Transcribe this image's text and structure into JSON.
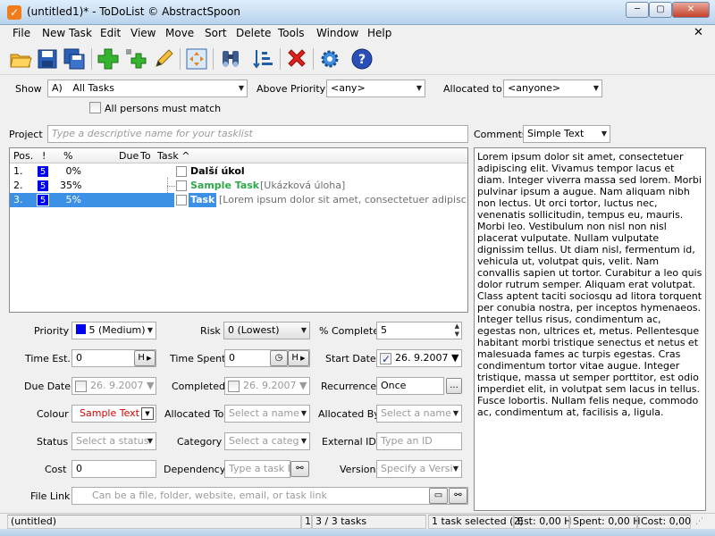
{
  "window": {
    "title": "(untitled1)* - ToDoList © AbstractSpoon",
    "minimize": "─",
    "maximize": "▢",
    "close": "✕"
  },
  "menu": [
    "File",
    "New Task",
    "Edit",
    "View",
    "Move",
    "Sort",
    "Delete",
    "Tools",
    "Window",
    "Help"
  ],
  "menu_close": "✕",
  "filter": {
    "show_label": "Show",
    "show_prefix": "A)",
    "show_value": "All Tasks",
    "above_priority_label": "Above Priority",
    "above_priority_value": "<any>",
    "allocated_to_label": "Allocated to",
    "allocated_to_value": "<anyone>",
    "all_persons_label": "All persons must match"
  },
  "project": {
    "label": "Project",
    "placeholder": "Type a descriptive name for your tasklist"
  },
  "comments_header": {
    "label": "Comments",
    "format": "Simple Text"
  },
  "tasklist": {
    "columns": {
      "pos": "Pos.",
      "flag": "!",
      "percent": "%",
      "due": "Due",
      "to": "To",
      "task": "Task ^"
    },
    "rows": [
      {
        "pos": "1.",
        "priority": "5",
        "percent": "0%",
        "title": "Další úkol",
        "comment": ""
      },
      {
        "pos": "2.",
        "priority": "5",
        "percent": "35%",
        "title": "Sample Task",
        "comment": "[Ukázková úloha]"
      },
      {
        "pos": "3.",
        "priority": "5",
        "percent": "5%",
        "title": "Task",
        "comment": "[Lorem ipsum dolor sit amet, consectetuer adipiscing elit. V"
      }
    ]
  },
  "comments_text": "Lorem ipsum dolor sit amet, consectetuer adipiscing elit. Vivamus tempor lacus et diam. Integer viverra massa sed lorem. Morbi pulvinar ipsum a augue. Nam aliquam nibh non lectus. Ut orci tortor, luctus nec, venenatis sollicitudin, tempus eu, mauris. Morbi leo. Vestibulum non nisl non nisl placerat vulputate. Nullam vulputate dignissim tellus. Ut diam nisl, fermentum id, vehicula ut, volutpat quis, velit. Nam convallis sapien ut tortor. Curabitur a leo quis dolor rutrum semper. Aliquam erat volutpat. Class aptent taciti sociosqu ad litora torquent per conubia nostra, per inceptos hymenaeos. Integer tellus risus, condimentum ac, egestas non, ultrices et, metus. Pellentesque habitant morbi tristique senectus et netus et malesuada fames ac turpis egestas. Cras condimentum tortor vitae augue. Integer tristique, massa ut semper porttitor, est odio imperdiet elit, in volutpat sem lacus in tellus. Fusce lobortis. Nullam felis neque, commodo ac, condimentum at, facilisis a, ligula.",
  "attributes": {
    "priority_label": "Priority",
    "priority_value": "5 (Medium)",
    "priority_color": "#0000f0",
    "risk_label": "Risk",
    "risk_value": "0 (Lowest)",
    "percent_label": "% Complete",
    "percent_value": "5",
    "time_est_label": "Time Est.",
    "time_est_value": "0",
    "time_est_unit": "H",
    "time_spent_label": "Time Spent",
    "time_spent_value": "0",
    "time_spent_unit": "H",
    "start_date_label": "Start Date",
    "start_date_value": "26.  9.2007",
    "due_date_label": "Due Date",
    "due_date_value": "26.  9.2007",
    "completed_label": "Completed",
    "completed_value": "26.  9.2007",
    "recurrence_label": "Recurrence",
    "recurrence_value": "Once",
    "recurrence_btn": "...",
    "colour_label": "Colour",
    "colour_value": "Sample Text",
    "colour_text_color": "#d40000",
    "allocated_to_label": "Allocated To",
    "allocated_to_placeholder": "Select a name",
    "allocated_by_label": "Allocated By",
    "allocated_by_placeholder": "Select a name",
    "status_label": "Status",
    "status_placeholder": "Select a status",
    "category_label": "Category",
    "category_placeholder": "Select a categ",
    "external_id_label": "External ID",
    "external_id_placeholder": "Type an ID",
    "cost_label": "Cost",
    "cost_value": "0",
    "dependency_label": "Dependency",
    "dependency_placeholder": "Type a task ID",
    "version_label": "Version",
    "version_placeholder": "Specify a Versi",
    "file_link_label": "File Link",
    "file_link_placeholder": "Can be a file, folder, website, email, or task link"
  },
  "statusbar": {
    "file": "(untitled)",
    "num": "1",
    "tasks": "3 / 3 tasks",
    "selected": "1 task selected (2)",
    "est": "Est: 0,00 H",
    "spent": "Spent: 0,00 H",
    "cost": "Cost: 0,00"
  },
  "toolbar_icons": [
    "open-folder-icon",
    "save-icon",
    "save-all-icon",
    "new-task-icon",
    "new-subtask-icon",
    "edit-pencil-icon",
    "maximize-view-icon",
    "find-binoculars-icon",
    "sort-icon",
    "delete-icon",
    "preferences-gear-icon",
    "help-icon"
  ]
}
